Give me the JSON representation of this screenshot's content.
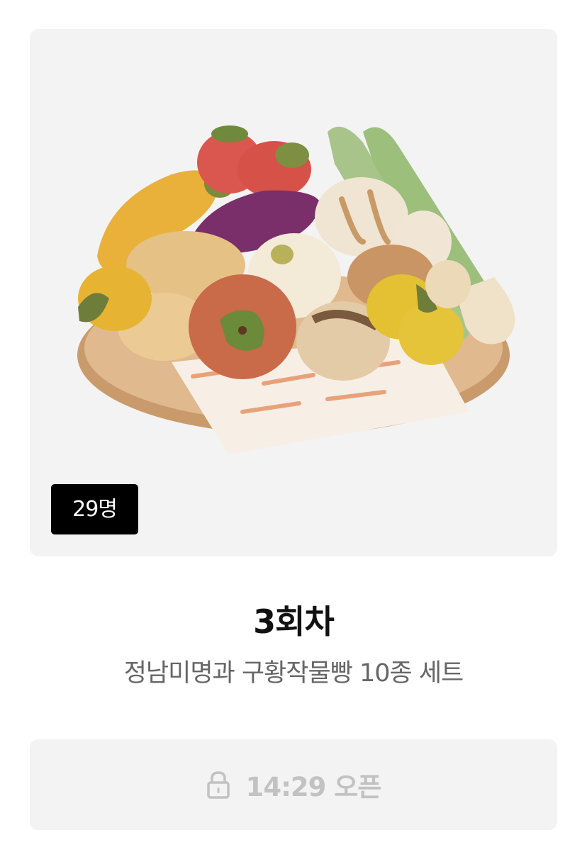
{
  "product": {
    "participant_count": "29명",
    "round_title": "3회차",
    "name": "정남미명과 구황작물빵 10종 세트",
    "image_icon": "bread-plate-image"
  },
  "open_button": {
    "label": "14:29 오픈",
    "icon": "lock-icon",
    "state": "locked"
  },
  "colors": {
    "card_background": "#f3f3f3",
    "badge_background": "#000000",
    "badge_text": "#ffffff",
    "title_text": "#111111",
    "subtitle_text": "#666666",
    "disabled_text": "#c2c2c2"
  }
}
